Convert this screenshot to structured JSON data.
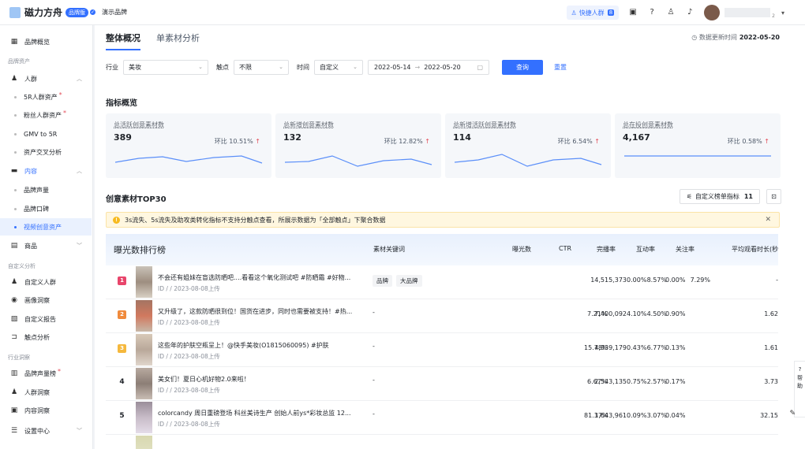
{
  "header": {
    "app_name": "磁力方舟",
    "badge": "品牌版",
    "brand": "演示品牌",
    "quick_crowd": "快捷人群",
    "quick_count": "8",
    "user_suffix": "2"
  },
  "sidebar": {
    "overview": "品牌概览",
    "sec_assets": "品牌资产",
    "crowd": "人群",
    "crowd_items": [
      "5R人群资产",
      "粉丝人群资产",
      "GMV to 5R",
      "资产交叉分析"
    ],
    "content": "内容",
    "content_items": [
      "品牌声量",
      "品牌口碑",
      "视频创意资产"
    ],
    "goods": "商品",
    "sec_custom": "自定义分析",
    "custom_items": [
      "自定义人群",
      "画像洞察",
      "自定义报告",
      "触点分析"
    ],
    "sec_industry": "行业洞察",
    "industry_items": [
      "品牌声量榜",
      "人群洞察",
      "内容洞察"
    ],
    "settings": "设置中心"
  },
  "tabs": [
    "整体概况",
    "单素材分析"
  ],
  "update": {
    "label": "数据更新时间",
    "date": "2022-05-20"
  },
  "filters": {
    "industry_label": "行业",
    "industry": "美妆",
    "touch_label": "触点",
    "touch": "不限",
    "time_label": "时间",
    "time": "自定义",
    "start": "2022-05-14",
    "end": "2022-05-20",
    "query": "查询",
    "reset": "重置"
  },
  "metrics_title": "指标概览",
  "metrics": [
    {
      "title": "总活跃创意素材数",
      "value": "389",
      "ratio": "环比 10.51%"
    },
    {
      "title": "总新增创意素材数",
      "value": "132",
      "ratio": "环比 12.82%"
    },
    {
      "title": "总新增活跃创意素材数",
      "value": "114",
      "ratio": "环比 6.54%"
    },
    {
      "title": "总在投创意素材数",
      "value": "4,167",
      "ratio": "环比 0.58%"
    }
  ],
  "top30": {
    "title": "创意素材TOP30",
    "custom_btn": "自定义榜单指标",
    "custom_count": "11",
    "warning": "3s流失、5s流失及助攻类转化指标不支持分触点查看，所展示数据为「全部触点」下聚合数据"
  },
  "table": {
    "main_header": "曝光数排行榜",
    "headers": [
      "素材关键词",
      "曝光数",
      "CTR",
      "完播率",
      "互动率",
      "关注率",
      "平均观看时长(秒"
    ],
    "rows": [
      {
        "rank": "1",
        "title": "不会还有姐妹在盲选防晒吧....看看这个氧化测试吧 #防晒霜 #好物...",
        "meta": "ID / / 2023-08-08上传",
        "kw": [
          "品牌",
          "大品牌"
        ],
        "exposure": "14,515,373",
        "ctr": "8.57%",
        "finish": "7.29%",
        "interact": "0.00%",
        "follow": "0.00%",
        "avg": "-"
      },
      {
        "rank": "2",
        "title": "又升级了，这款防晒很到位！国货在进步，同时也需要被支持！#热...",
        "meta": "ID / / 2023-08-08上传",
        "kw": [
          "-"
        ],
        "exposure": "7,400,092",
        "ctr": "4.50%",
        "finish": "7.21%",
        "interact": "4.10%",
        "follow": "0.90%",
        "avg": "1.62"
      },
      {
        "rank": "3",
        "title": "这些年的护肤空瓶呈上！@快手美妆(O1815060095) #护肤",
        "meta": "ID / / 2023-08-08上传",
        "kw": [
          "-"
        ],
        "exposure": "4,939,179",
        "ctr": "6.77%",
        "finish": "15.78%",
        "interact": "0.43%",
        "follow": "0.13%",
        "avg": "1.61"
      },
      {
        "rank": "4",
        "title": "美女们！夏日心机好物2.0来啦！",
        "meta": "ID / / 2023-08-08上传",
        "kw": [
          "-"
        ],
        "exposure": "2,543,135",
        "ctr": "2.57%",
        "finish": "6.67%",
        "interact": "0.75%",
        "follow": "0.17%",
        "avg": "3.73"
      },
      {
        "rank": "5",
        "title": "colorcandy 周日重磅登场 科丝美诗生产 创始人前ys*彩妆总监 12...",
        "meta": "ID / / 2023-08-08上传",
        "kw": [
          "-"
        ],
        "exposure": "1,643,961",
        "ctr": "3.07%",
        "finish": "81.37%",
        "interact": "0.09%",
        "follow": "0.04%",
        "avg": "32.15"
      }
    ]
  },
  "help": "帮助"
}
